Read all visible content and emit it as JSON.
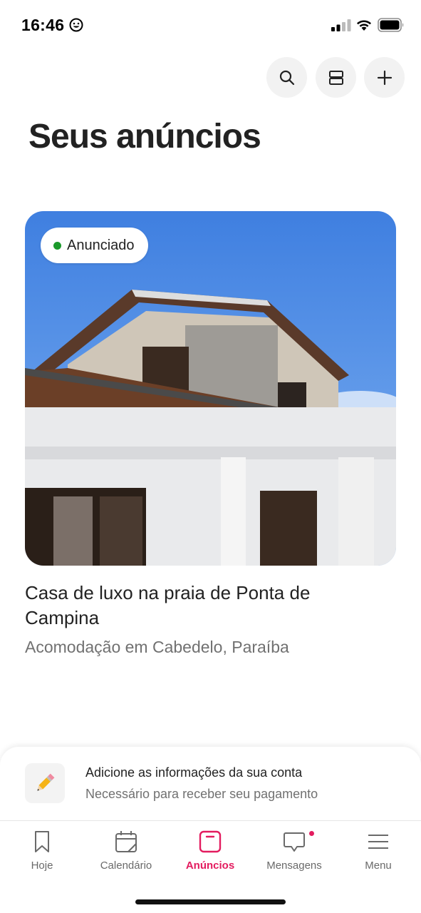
{
  "status_bar": {
    "time": "16:46",
    "icons": [
      "smiley-icon",
      "cellular-signal-icon",
      "wifi-icon",
      "battery-icon"
    ]
  },
  "toolbar": {
    "buttons": [
      {
        "name": "search",
        "icon": "search-icon"
      },
      {
        "name": "view-toggle",
        "icon": "stack-view-icon"
      },
      {
        "name": "add",
        "icon": "plus-icon"
      }
    ]
  },
  "page": {
    "title": "Seus anúncios"
  },
  "listing": {
    "status_badge": "Anunciado",
    "status_color": "#1b9a2b",
    "title": "Casa de luxo na praia de Ponta de Campina",
    "subtitle": "Acomodação em Cabedelo, Paraíba"
  },
  "account_banner": {
    "icon": "pencil-icon",
    "title": "Adicione as informações da sua conta",
    "subtitle": "Necessário para receber seu pagamento"
  },
  "tabbar": {
    "accent_color": "#e31c5f",
    "items": [
      {
        "label": "Hoje",
        "icon": "bookmark-icon",
        "active": false
      },
      {
        "label": "Calendário",
        "icon": "calendar-icon",
        "active": false
      },
      {
        "label": "Anúncios",
        "icon": "listings-icon",
        "active": true
      },
      {
        "label": "Mensagens",
        "icon": "message-icon",
        "active": false,
        "has_notification": true
      },
      {
        "label": "Menu",
        "icon": "menu-icon",
        "active": false
      }
    ]
  }
}
